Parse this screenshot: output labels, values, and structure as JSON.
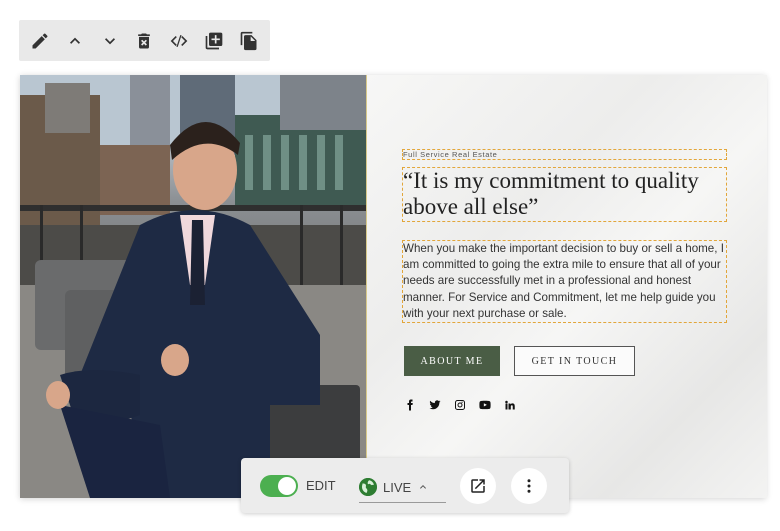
{
  "toolbar": {
    "icons": [
      "edit-icon",
      "move-up-icon",
      "move-down-icon",
      "delete-icon",
      "code-icon",
      "add-section-icon",
      "duplicate-icon"
    ]
  },
  "hero": {
    "eyebrow": "Full Service Real Estate",
    "quote": "“It is my commitment to quality above all else”",
    "paragraph": "When you make the important decision to buy or sell a home, I am committed to going the extra mile to ensure that all of your needs are successfully met in a professional and honest manner. For Service and Commitment, let me help guide you with your next purchase or sale.",
    "about_button": "ABOUT ME",
    "contact_button": "GET IN TOUCH",
    "social": [
      "facebook-icon",
      "twitter-icon",
      "instagram-icon",
      "youtube-icon",
      "linkedin-icon"
    ],
    "accent_color": "#4a5d45"
  },
  "bottombar": {
    "edit_label": "EDIT",
    "live_label": "LIVE",
    "toggle_on": true
  }
}
